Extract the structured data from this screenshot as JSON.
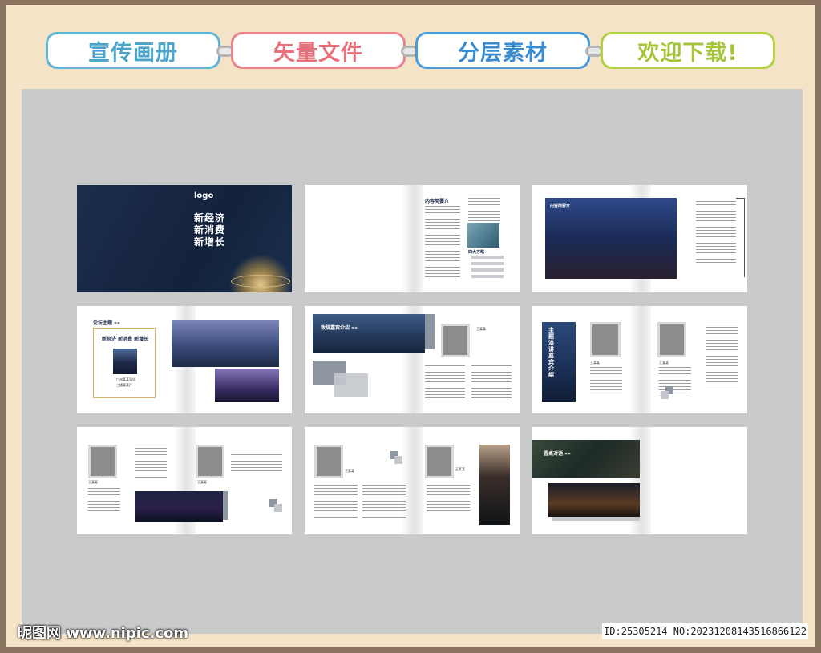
{
  "banner": {
    "tags": [
      {
        "label": "宣传画册",
        "color": "#4aa3c8"
      },
      {
        "label": "矢量文件",
        "color": "#e8707a"
      },
      {
        "label": "分层素材",
        "color": "#3a8bd0"
      },
      {
        "label": "欢迎下载!",
        "color": "#a5c43a"
      }
    ]
  },
  "cover": {
    "logo": "logo",
    "line1": "新经济",
    "line2": "新消费",
    "line3": "新增长"
  },
  "pages": {
    "p2_title": "内容简要介",
    "p2_sub": "四大方略",
    "p3_title": "内容简要介",
    "p4_title": "论坛主题 »»",
    "p4_slogan": "新经济 新消费 新增长",
    "p4_place": "广州某某酒店",
    "p4_hall": "三楼某某厅",
    "p5_title": "致辞嘉宾介绍 »»",
    "p5_name": "王某某",
    "p6_title": "主题演讲嘉宾介绍",
    "p6_name1": "王某某",
    "p6_name2": "王某某",
    "p7_name1": "王某某",
    "p7_name2": "王某某",
    "p8_name1": "王某某",
    "p8_name2": "王某某",
    "p9_title": "圆桌对话 »»"
  },
  "watermark": {
    "site": "昵图网 www.nipic.com",
    "id": "ID:25305214 NO:20231208143516866122"
  }
}
